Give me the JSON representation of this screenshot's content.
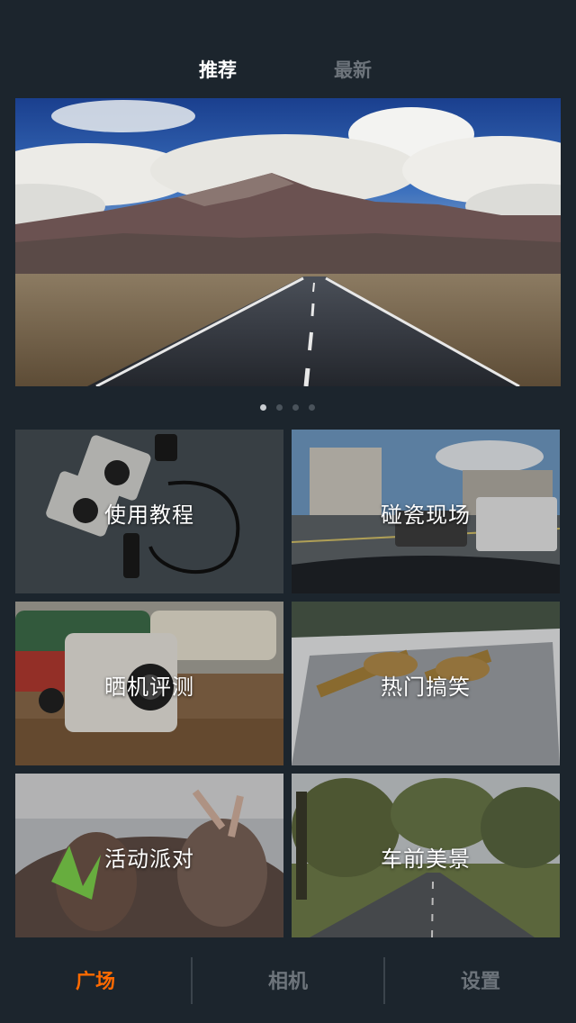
{
  "top_tabs": [
    {
      "label": "推荐",
      "active": true
    },
    {
      "label": "最新",
      "active": false
    }
  ],
  "banner": {
    "scene": "mountain-road",
    "pages": 4,
    "current_page": 1
  },
  "tiles": [
    {
      "label": "使用教程",
      "scene": "dashcam-accessories"
    },
    {
      "label": "碰瓷现场",
      "scene": "street-intersection"
    },
    {
      "label": "晒机评测",
      "scene": "camera-and-toy-van"
    },
    {
      "label": "热门搞笑",
      "scene": "deer-crossing-road"
    },
    {
      "label": "活动派对",
      "scene": "concert-crowd"
    },
    {
      "label": "车前美景",
      "scene": "tree-lined-road"
    }
  ],
  "bottom_nav": [
    {
      "label": "广场",
      "active": true
    },
    {
      "label": "相机",
      "active": false
    },
    {
      "label": "设置",
      "active": false
    }
  ],
  "colors": {
    "background": "#1c252d",
    "active_tab_text": "#ffffff",
    "inactive_text": "#6d747b",
    "accent_orange": "#ff6a00"
  }
}
